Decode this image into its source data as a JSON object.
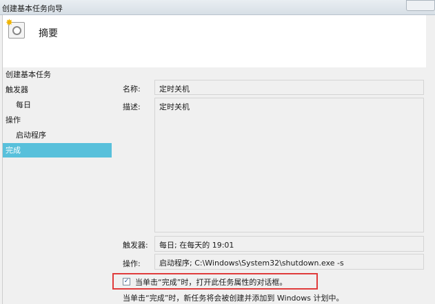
{
  "window": {
    "title": "创建基本任务向导"
  },
  "header": {
    "title": "摘要"
  },
  "nav": {
    "items": [
      {
        "label": "创建基本任务"
      },
      {
        "label": "触发器"
      },
      {
        "label": "每日"
      },
      {
        "label": "操作"
      },
      {
        "label": "启动程序"
      },
      {
        "label": "完成"
      }
    ]
  },
  "form": {
    "name_label": "名称:",
    "name_value": "定时关机",
    "desc_label": "描述:",
    "desc_value": "定时关机",
    "trigger_label": "触发器:",
    "trigger_value": "每日; 在每天的 19:01",
    "action_label": "操作:",
    "action_value": "启动程序; C:\\Windows\\System32\\shutdown.exe -s",
    "open_props_checkbox": "当单击“完成”时，打开此任务属性的对话框。",
    "open_props_checked": true,
    "footer_note": "当单击“完成”时，新任务将会被创建并添加到 Windows 计划中。"
  },
  "colors": {
    "selected": "#58c0db",
    "highlight": "#e03a3a"
  }
}
